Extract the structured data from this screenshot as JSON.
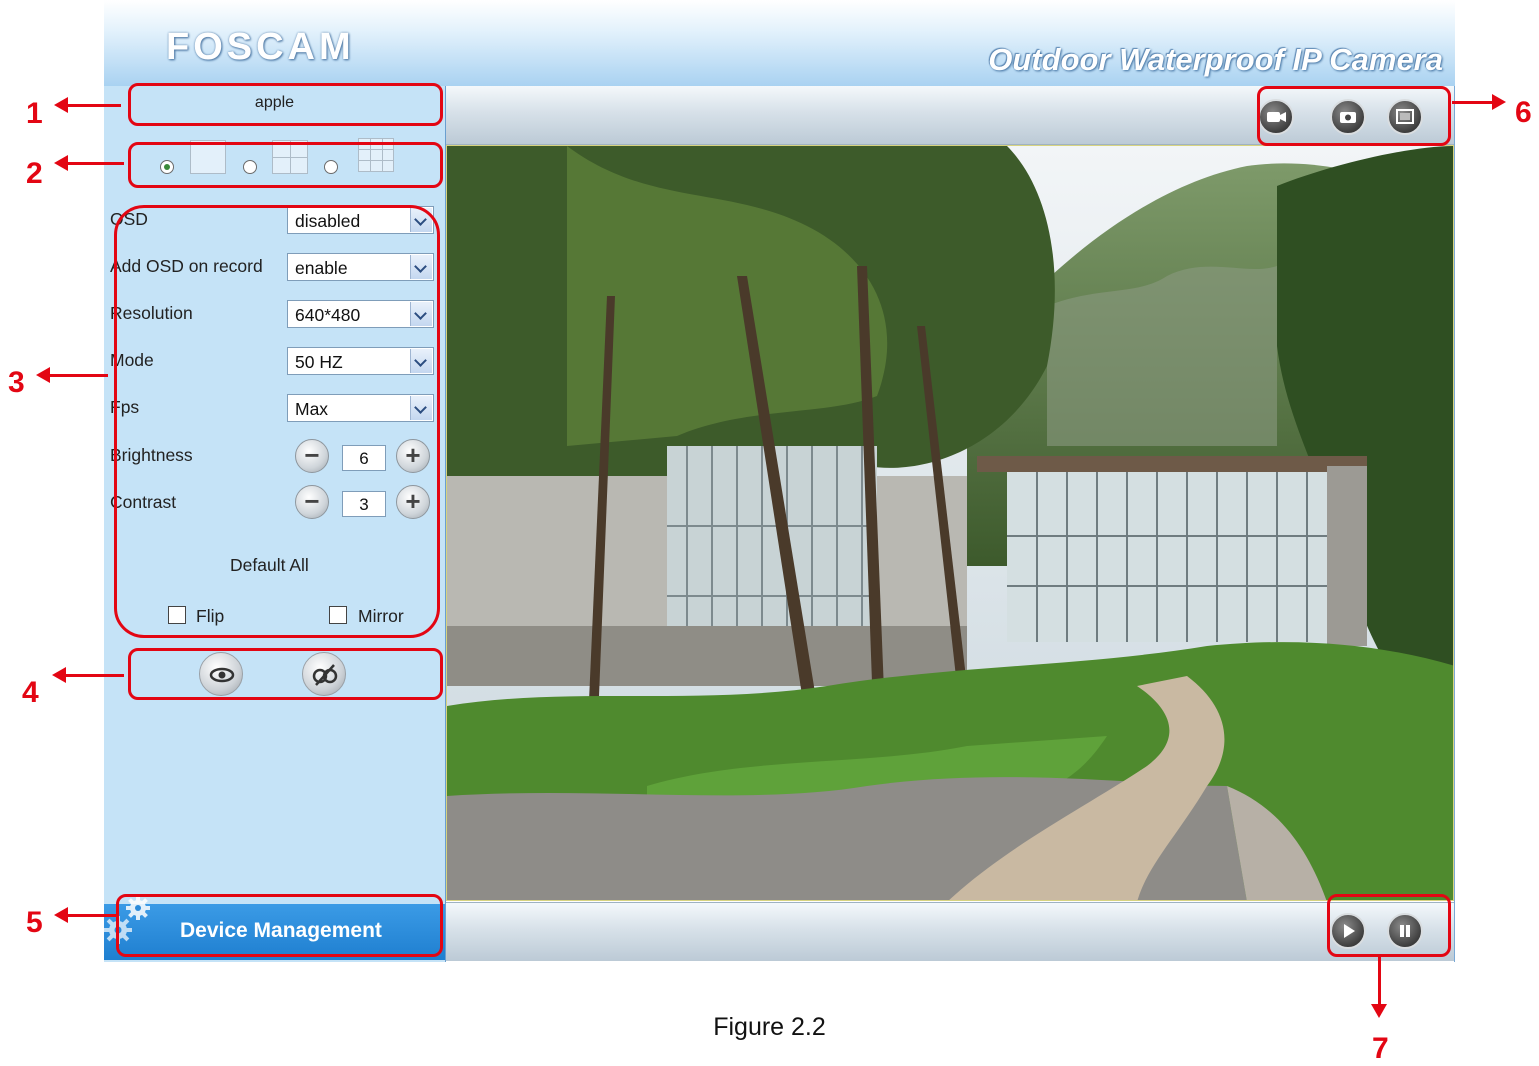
{
  "header": {
    "logo": "FOSCAM",
    "product": "Outdoor Waterproof IP Camera"
  },
  "sidebar": {
    "device_name": "apple",
    "layout_options": [
      {
        "name": "1-view",
        "selected": true
      },
      {
        "name": "4-view",
        "selected": false
      },
      {
        "name": "9-view",
        "selected": false
      }
    ],
    "params": [
      {
        "label": "OSD",
        "value": "disabled"
      },
      {
        "label": "Add OSD on record",
        "value": "enable"
      },
      {
        "label": "Resolution",
        "value": "640*480"
      },
      {
        "label": "Mode",
        "value": "50 HZ"
      },
      {
        "label": "Fps",
        "value": "Max"
      }
    ],
    "brightness": {
      "label": "Brightness",
      "value": "6"
    },
    "contrast": {
      "label": "Contrast",
      "value": "3"
    },
    "default_all": "Default All",
    "flip": {
      "label": "Flip",
      "checked": false
    },
    "mirror": {
      "label": "Mirror",
      "checked": false
    },
    "ir_buttons": [
      "eye-icon",
      "ir-off-icon"
    ],
    "device_management": "Device Management"
  },
  "toolbar": {
    "icons": [
      "record-icon",
      "snapshot-icon",
      "fullscreen-icon"
    ]
  },
  "playback": {
    "icons": [
      "play-icon",
      "stop-icon"
    ]
  },
  "annotations": [
    "1",
    "2",
    "3",
    "4",
    "5",
    "6",
    "7"
  ],
  "caption": "Figure 2.2",
  "colors": {
    "annotation": "#e30613",
    "sidebar_bg": "#c5e3f7",
    "device_mgmt_bg": "#2a8ad9"
  }
}
